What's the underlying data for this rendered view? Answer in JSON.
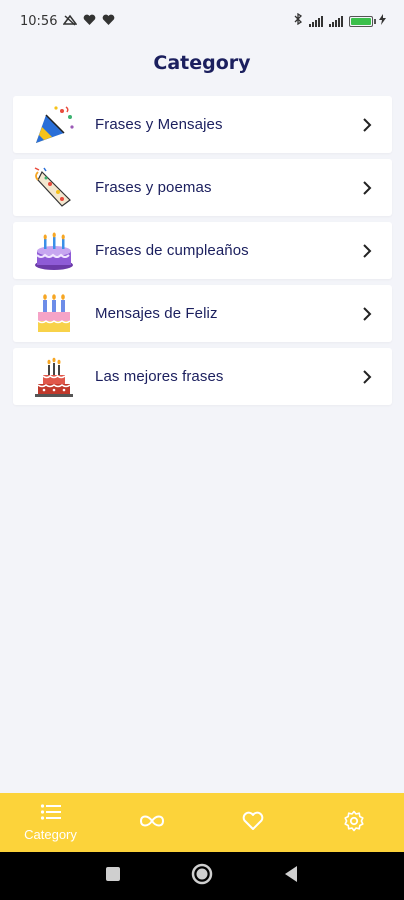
{
  "status_bar": {
    "time": "10:56",
    "left_icons": [
      "notification-icon",
      "heart-icon",
      "heart-icon"
    ],
    "right_icons": [
      "bluetooth-icon",
      "signal-icon",
      "signal-icon",
      "battery-icon",
      "charging-icon"
    ],
    "battery_level": 1.0
  },
  "header": {
    "title": "Category"
  },
  "categories": [
    {
      "label": "Frases y Mensajes",
      "icon": "party-popper-icon"
    },
    {
      "label": "Frases y poemas",
      "icon": "party-horn-icon"
    },
    {
      "label": "Frases de cumpleaños",
      "icon": "birthday-cake-icon"
    },
    {
      "label": "Mensajes de Feliz",
      "icon": "candles-cake-icon"
    },
    {
      "label": "Las mejores frases",
      "icon": "tiered-cake-icon"
    }
  ],
  "bottom_nav": {
    "items": [
      {
        "label": "Category",
        "icon": "list-icon",
        "active": true
      },
      {
        "label": "",
        "icon": "infinity-icon",
        "active": false
      },
      {
        "label": "",
        "icon": "heart-icon",
        "active": false
      },
      {
        "label": "",
        "icon": "settings-gear-icon",
        "active": false
      }
    ],
    "background": "#fcd33a"
  },
  "system_nav": {
    "icons": [
      "square-icon",
      "circle-icon",
      "back-triangle-icon"
    ]
  },
  "colors": {
    "accent": "#fcd33a",
    "title": "#1b1f5e",
    "background": "#f3f4f9"
  }
}
